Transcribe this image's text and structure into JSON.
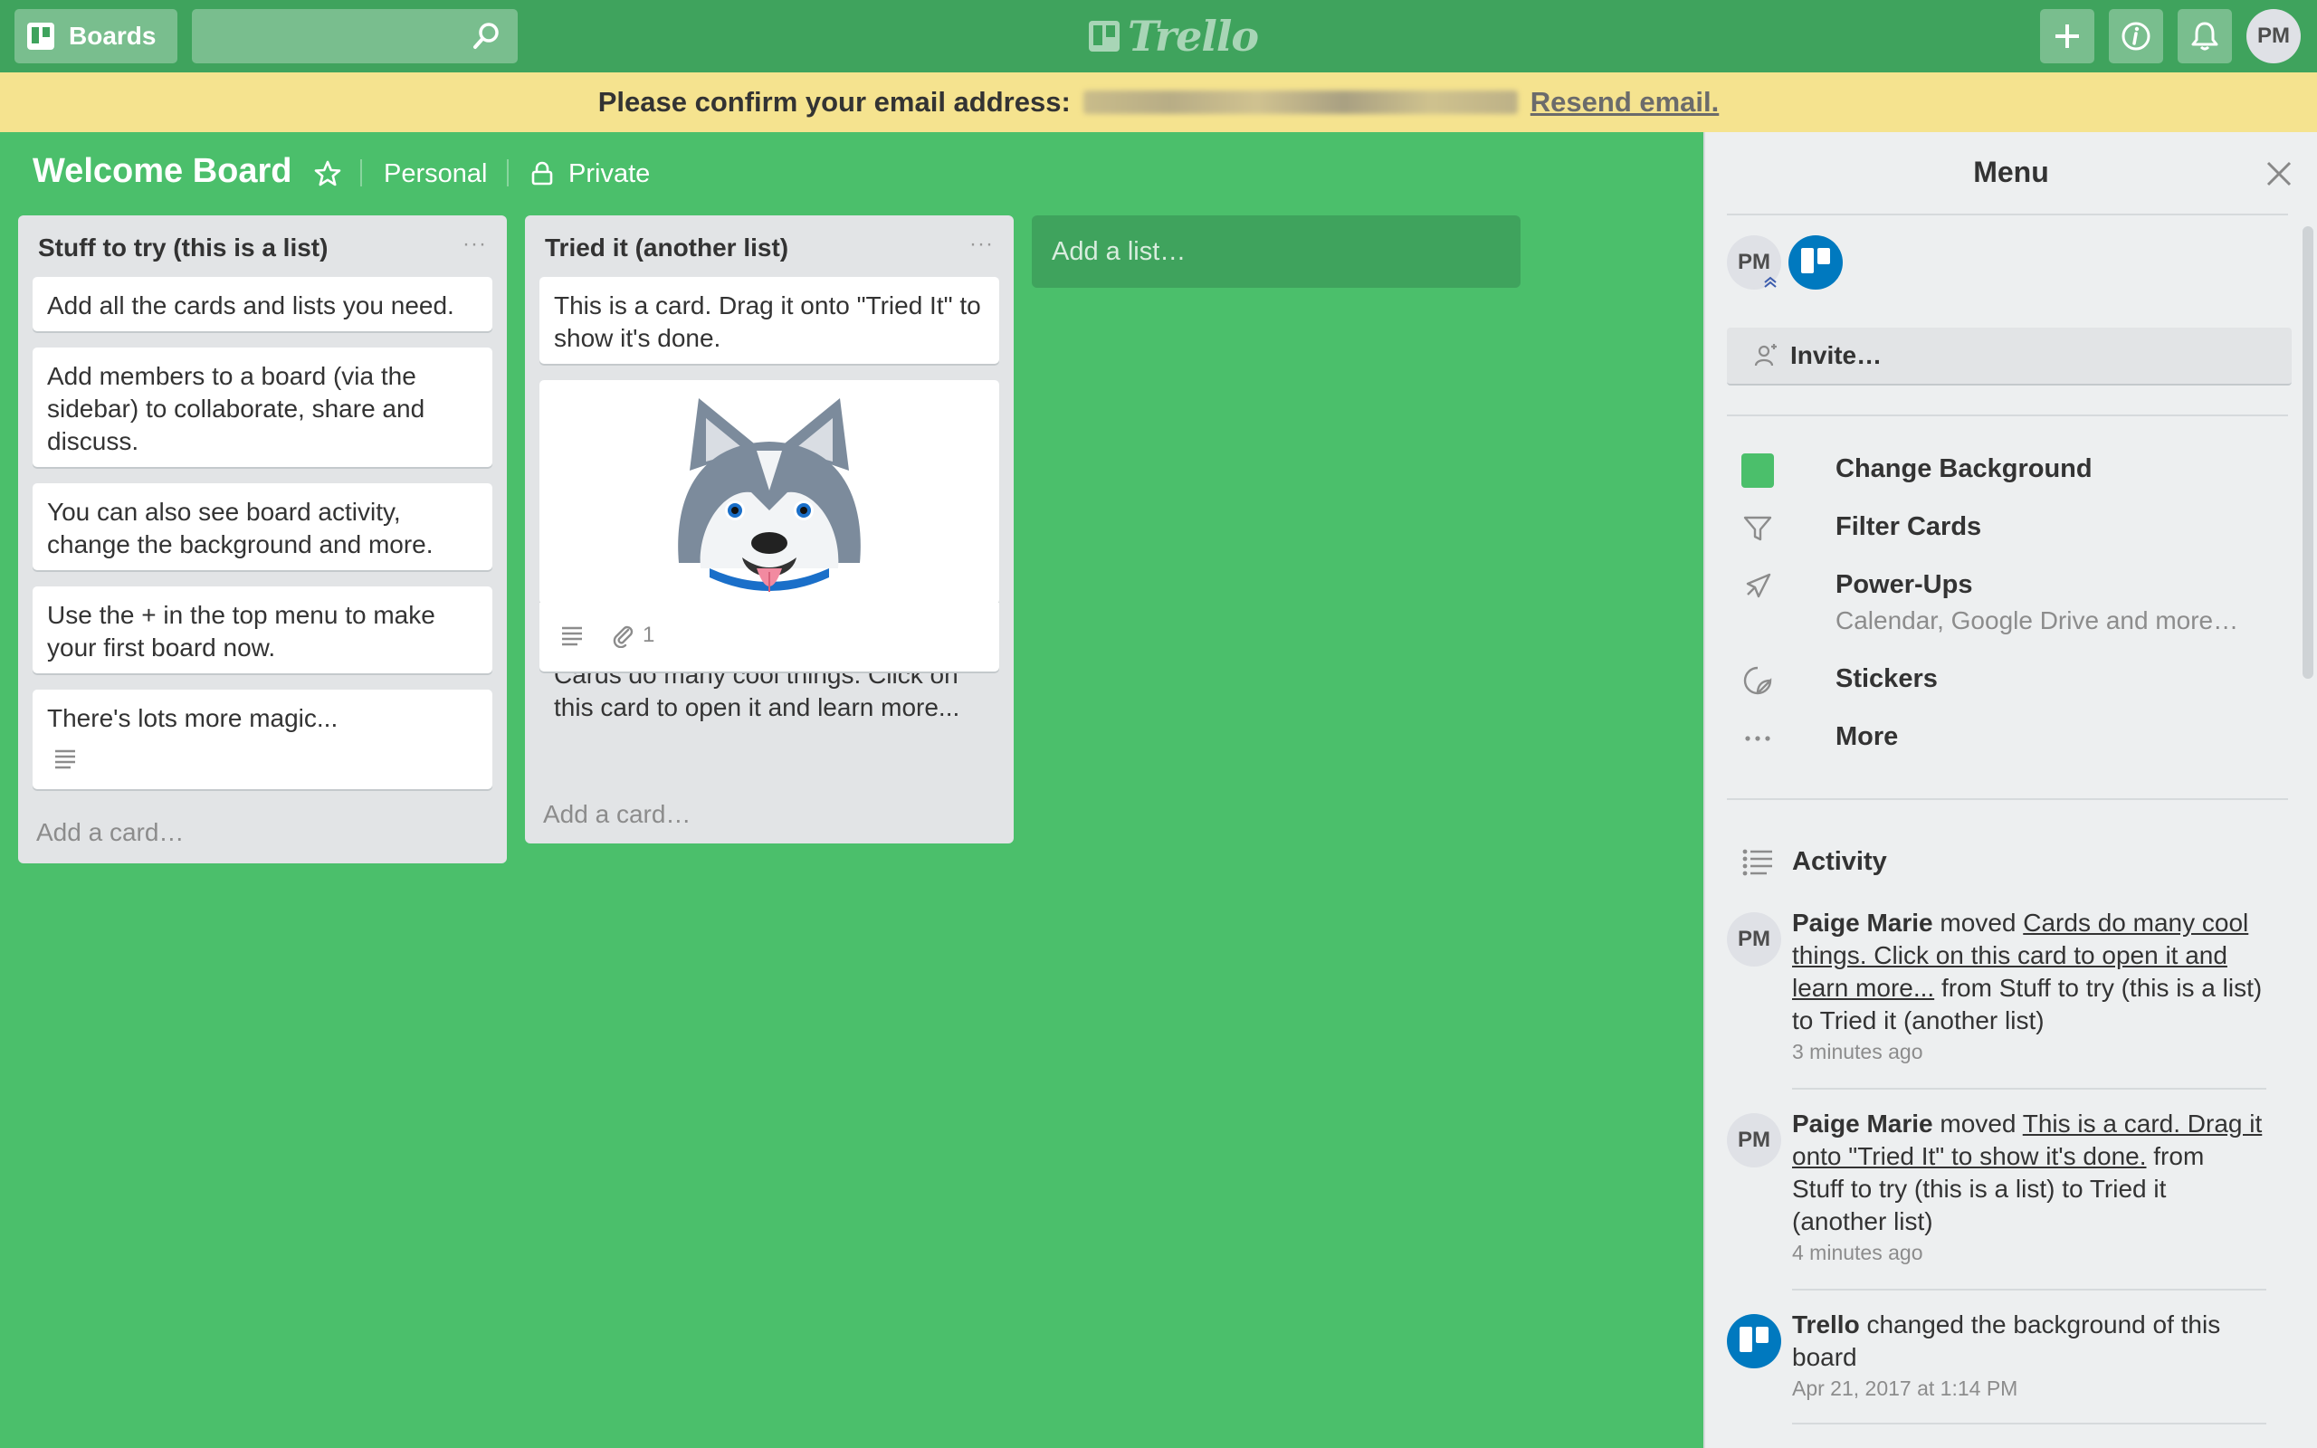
{
  "header": {
    "boards_label": "Boards",
    "search_placeholder": "",
    "logo_text": "Trello",
    "user_initials": "PM"
  },
  "banner": {
    "text": "Please confirm your email address:",
    "resend_label": "Resend email."
  },
  "board": {
    "title": "Welcome Board",
    "team": "Personal",
    "visibility": "Private"
  },
  "lists": [
    {
      "title": "Stuff to try (this is a list)",
      "menu": "···",
      "cards": [
        "Add all the cards and lists you need.",
        "Add members to a board (via the sidebar) to collaborate, share and discuss.",
        "You can also see board activity, change the background and more.",
        "Use the + in the top menu to make your first board now.",
        "There's lots more magic..."
      ],
      "add_card": "Add a card…"
    },
    {
      "title": "Tried it (another list)",
      "menu": "···",
      "cards": [
        "This is a card. Drag it onto \"Tried It\" to show it's done.",
        "Cards do many cool things. Click on this card to open it and learn more..."
      ],
      "attachment_count": "1",
      "add_card": "Add a card…"
    }
  ],
  "add_list": "Add a list…",
  "sidebar": {
    "title": "Menu",
    "member_initials": "PM",
    "invite_label": "Invite…",
    "menu": {
      "change_background": "Change Background",
      "filter_cards": "Filter Cards",
      "power_ups": "Power-Ups",
      "power_ups_sub": "Calendar, Google Drive and more…",
      "stickers": "Stickers",
      "more": "More"
    },
    "activity_title": "Activity",
    "activity": [
      {
        "initials": "PM",
        "user": "Paige Marie",
        "verb": "moved",
        "link": "Cards do many cool things. Click on this card to open it and learn more...",
        "rest": "from Stuff to try (this is a list) to Tried it (another list)",
        "time": "3 minutes ago"
      },
      {
        "initials": "PM",
        "user": "Paige Marie",
        "verb": "moved",
        "link": "This is a card. Drag it onto \"Tried It\" to show it's done.",
        "rest": "from Stuff to try (this is a list) to Tried it (another list)",
        "time": "4 minutes ago"
      },
      {
        "user": "Trello",
        "verb": "changed the background of this board",
        "time": "Apr 21, 2017 at 1:14 PM"
      }
    ]
  },
  "colors": {
    "board_bg": "#4bbf6b",
    "header_bg": "#3fa35d",
    "banner_bg": "#f5e38f",
    "trello_blue": "#0079bf"
  }
}
